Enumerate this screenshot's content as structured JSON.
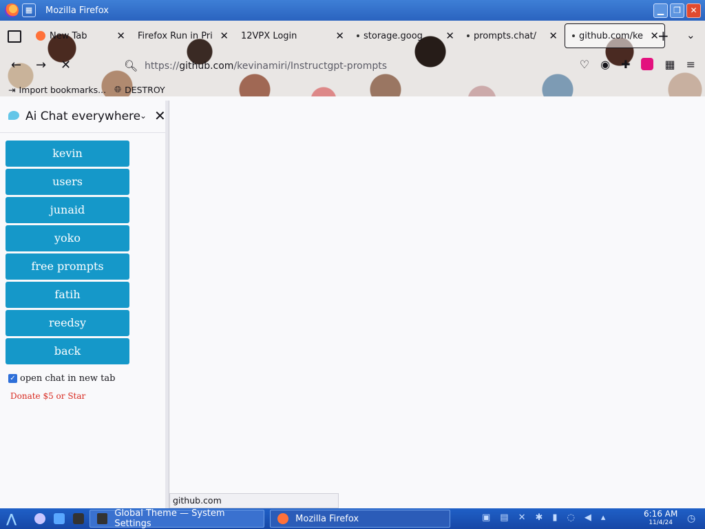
{
  "window": {
    "title": "Mozilla Firefox",
    "buttons": {
      "minimize": "▁",
      "maximize": "❐",
      "close": "✕"
    }
  },
  "tabs": [
    {
      "label": "New Tab",
      "close": "✕"
    },
    {
      "label": "Firefox Run in Pri",
      "close": "✕"
    },
    {
      "label": "12VPX Login",
      "close": "✕"
    },
    {
      "label": "storage.goog",
      "close": "✕"
    },
    {
      "label": "prompts.chat/",
      "close": "✕"
    },
    {
      "label": "github.com/ke",
      "close": "✕"
    }
  ],
  "tabbar": {
    "new_tab": "+",
    "list_all": "⌄"
  },
  "nav": {
    "back": "←",
    "forward": "→",
    "stop": "✕",
    "url": {
      "scheme": "https://",
      "host": "github.com",
      "path": "/kevinamiri/Instructgpt-prompts"
    }
  },
  "bookmarks": [
    {
      "label": "Import bookmarks...",
      "icon": "import-icon"
    },
    {
      "label": "DESTROY",
      "icon": "globe-icon"
    }
  ],
  "sidebar": {
    "title": "Ai Chat everywhere",
    "chevron": "⌄",
    "close": "✕",
    "buttons": [
      "kevin",
      "users",
      "junaid",
      "yoko",
      "free prompts",
      "fatih",
      "reedsy",
      "back"
    ],
    "checkbox_label": "open chat in new tab",
    "checkbox_checked": true,
    "donate": "Donate $5 or Star"
  },
  "status": {
    "url": "github.com"
  },
  "taskbar": {
    "tasks": [
      {
        "label": "Global Theme — System Settings"
      },
      {
        "label": "Mozilla Firefox"
      }
    ],
    "clock": {
      "time": "6:16 AM",
      "date": "11/4/24"
    }
  },
  "colors": {
    "accent": "#1598c9",
    "titlebar": "#2a63bf",
    "donate": "#d8281e"
  }
}
